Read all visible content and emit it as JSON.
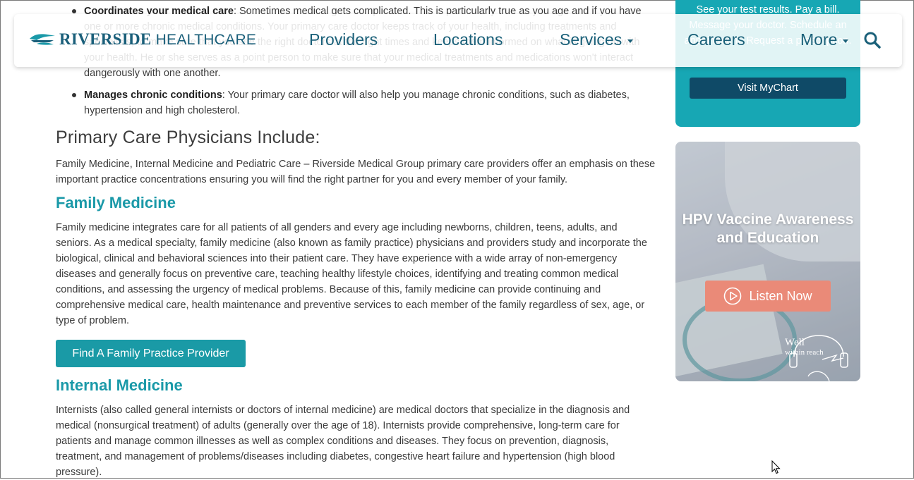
{
  "header": {
    "logo_bold": "RIVERSIDE",
    "logo_light": "HEALTHCARE",
    "nav": {
      "providers": "Providers",
      "locations": "Locations",
      "services": "Services",
      "careers": "Careers",
      "more": "More"
    }
  },
  "content": {
    "bullets": [
      {
        "title": "Coordinates your medical care",
        "text": ": Sometimes medical gets complicated.  This is particularly true as you age and if you have one or more chronic medical conditions. Your primary care doctor keeps track of your health, including treatments and specialists, to make sure that you see the right doctors at the right times and keeps them informed on what is going on with your health.  He or she serves as a point person to make sure that your medical treatments and medications won't interact dangerously with one another."
      },
      {
        "title": "Manages chronic conditions",
        "text": ":  Your primary care doctor will also help you manage chronic conditions, such as diabetes, hypertension and high cholesterol."
      }
    ],
    "primary_heading": "Primary Care Physicians Include:",
    "primary_intro": "Family Medicine, Internal Medicine and Pediatric Care – Riverside Medical Group primary care providers offer an emphasis on these important practice concentrations ensuring you will find the right partner for you and every member of your family.",
    "family_heading": "Family Medicine",
    "family_text": "Family medicine integrates care for all patients of all genders and every age including newborns, children, teens, adults, and seniors. As a medical specialty, family medicine (also known as family practice) physicians and providers study and incorporate the biological, clinical and behavioral sciences into their patient care.  They have experience with a wide array of non-emergency diseases and generally focus on preventive care, teaching healthy lifestyle choices, identifying and treating common medical conditions, and assessing the urgency of medical problems.  Because of this, family medicine can provide continuing and comprehensive medical care, health maintenance and preventive services to each member of the family regardless of sex, age, or type of problem.",
    "family_button": "Find A Family Practice Provider",
    "internal_heading": "Internal Medicine",
    "internal_text": "Internists (also called general internists or doctors of internal medicine) are medical doctors that specialize in the diagnosis and medical (nonsurgical treatment) of adults (generally over the age of 18).  Internists provide comprehensive, long-term care for patients and manage common illnesses as well as complex conditions and diseases.  They focus on prevention, diagnosis, treatment, and management of problems/diseases including diabetes, congestive heart failure and hypertension (high blood pressure)."
  },
  "sidebar": {
    "mychart_text": "See your test results. Pay a bill. Message your doctor. Schedule an appointment. Request a prescription.",
    "mychart_button": "Visit MyChart",
    "promo_title": "HPV Vaccine Awareness and Education",
    "promo_button": "Listen Now",
    "wwr_line1": "Well",
    "wwr_line2": "within reach"
  },
  "icons": {
    "search": "search-icon",
    "play": "play-icon",
    "caret": "caret-down-icon",
    "cursor": "mouse-pointer-icon"
  },
  "colors": {
    "brand_navy": "#1a5f7a",
    "teal_heading": "#1a99a8",
    "teal_button": "#1a9aa6",
    "mychart_card": "#17a7b4",
    "mychart_button": "#0f4a67",
    "listen_button": "#ea8a78"
  }
}
